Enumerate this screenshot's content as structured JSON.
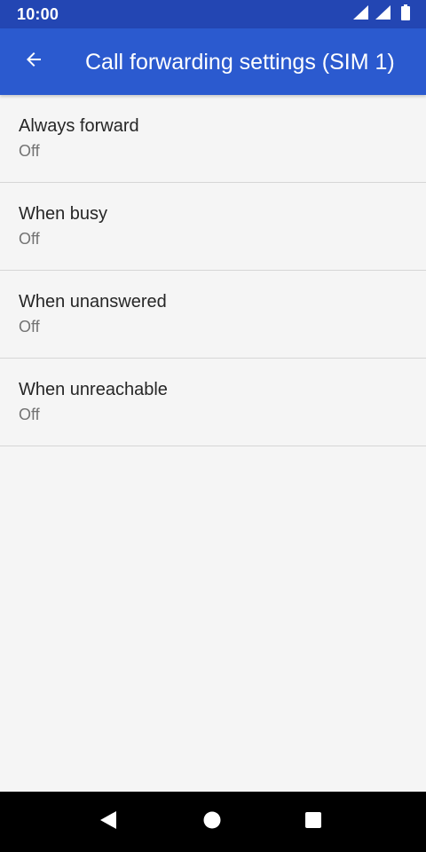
{
  "status_bar": {
    "time": "10:00",
    "icons": [
      "wifi-signal-icon",
      "cell-signal-icon",
      "battery-icon"
    ]
  },
  "app_bar": {
    "back_icon": "arrow-back-icon",
    "title": "Call forwarding settings (SIM 1)",
    "background_color": "#2b5acf",
    "status_bar_color": "#2346b3"
  },
  "settings": [
    {
      "title": "Always forward",
      "summary": "Off"
    },
    {
      "title": "When busy",
      "summary": "Off"
    },
    {
      "title": "When unanswered",
      "summary": "Off"
    },
    {
      "title": "When unreachable",
      "summary": "Off"
    }
  ],
  "nav_bar": {
    "buttons": [
      "nav-back-icon",
      "nav-home-icon",
      "nav-recents-icon"
    ]
  }
}
